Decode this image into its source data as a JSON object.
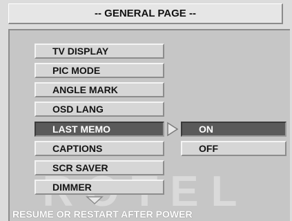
{
  "header": {
    "title": "-- GENERAL PAGE --"
  },
  "menu": {
    "items": [
      {
        "label": "TV DISPLAY"
      },
      {
        "label": "PIC MODE"
      },
      {
        "label": "ANGLE MARK"
      },
      {
        "label": "OSD LANG"
      },
      {
        "label": "LAST MEMO"
      },
      {
        "label": "CAPTIONS"
      },
      {
        "label": "SCR SAVER"
      },
      {
        "label": "DIMMER"
      }
    ],
    "selected_label": "LAST MEMO"
  },
  "options": {
    "items": [
      {
        "label": "ON"
      },
      {
        "label": "OFF"
      }
    ],
    "selected_label": "ON"
  },
  "watermark": "ROTEL",
  "status": {
    "text": "RESUME OR RESTART AFTER POWER"
  },
  "icons": {
    "submenu": "triangle-right-icon",
    "scroll": "triangle-down-icon"
  },
  "colors": {
    "background": "#c6c6c6",
    "selected": "#5a5a5a",
    "button": "#d6d6d6"
  }
}
